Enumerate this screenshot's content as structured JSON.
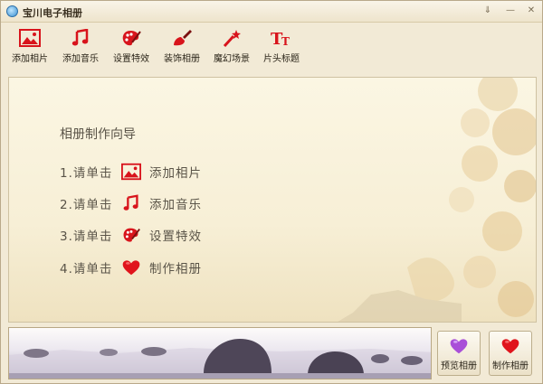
{
  "window": {
    "title": "宝川电子相册",
    "icon": "app-logo-icon"
  },
  "toolbar": {
    "items": [
      {
        "label": "添加相片",
        "icon": "picture-icon"
      },
      {
        "label": "添加音乐",
        "icon": "music-note-icon"
      },
      {
        "label": "设置特效",
        "icon": "palette-icon"
      },
      {
        "label": "装饰相册",
        "icon": "brush-icon"
      },
      {
        "label": "魔幻场景",
        "icon": "magic-wand-icon"
      },
      {
        "label": "片头标题",
        "icon": "title-text-icon"
      }
    ]
  },
  "wizard": {
    "title": "相册制作向导",
    "steps": [
      {
        "prefix": "1.请单击",
        "action": "添加相片",
        "icon": "picture-icon"
      },
      {
        "prefix": "2.请单击",
        "action": "添加音乐",
        "icon": "music-note-icon"
      },
      {
        "prefix": "3.请单击",
        "action": "设置特效",
        "icon": "palette-icon"
      },
      {
        "prefix": "4.请单击",
        "action": "制作相册",
        "icon": "heart-icon"
      }
    ]
  },
  "actions": {
    "preview_label": "预览相册",
    "make_label": "制作相册"
  },
  "colors": {
    "accent_red": "#d8141c",
    "preview_purple": "#a94fd8",
    "panel_bg": "#f7efd6"
  }
}
